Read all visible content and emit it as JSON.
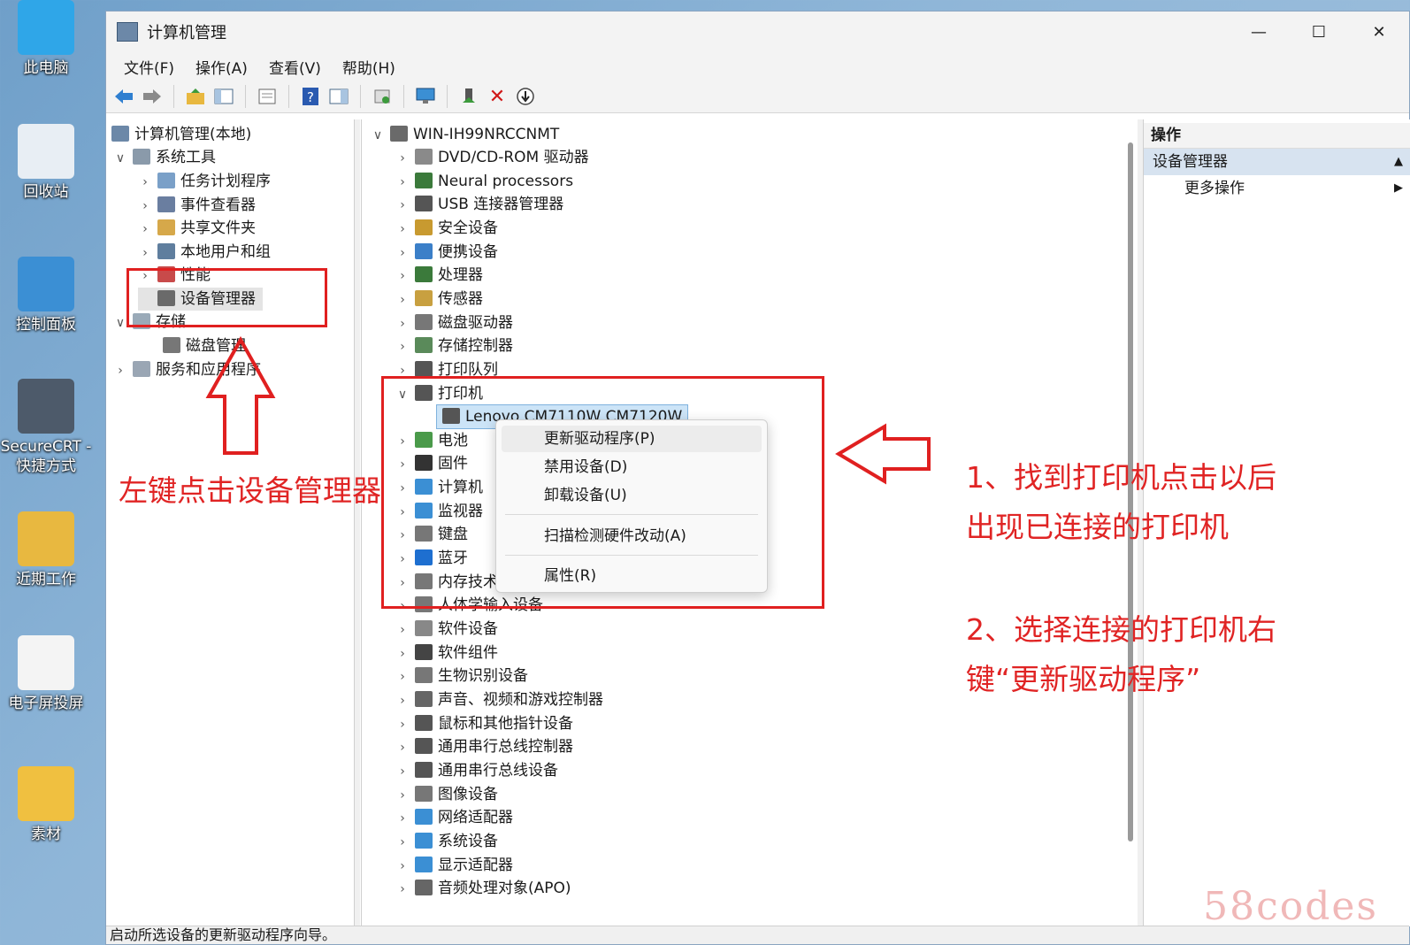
{
  "desktop": {
    "icons": [
      {
        "label": "此电脑",
        "color": "#2fa6e8"
      },
      {
        "label": "回收站",
        "color": "#e8eef4"
      },
      {
        "label": "控制面板",
        "color": "#3b8fd4"
      },
      {
        "label": "SecureCRT - 快捷方式",
        "color": "#4d5a6a"
      },
      {
        "label": "近期工作",
        "color": "#e8b840"
      },
      {
        "label": "电子屏投屏",
        "color": "#f4f4f4"
      },
      {
        "label": "素材",
        "color": "#f0c040"
      }
    ]
  },
  "window": {
    "title": "计算机管理",
    "controls": {
      "minimize": "—",
      "maximize": "☐",
      "close": "✕"
    },
    "menu": [
      "文件(F)",
      "操作(A)",
      "查看(V)",
      "帮助(H)"
    ],
    "toolbar_icons": [
      "back-arrow",
      "forward-arrow",
      "up-folder",
      "show-hide-tree",
      "properties",
      "help",
      "show-pane",
      "export",
      "scan-hardware",
      "add-driver",
      "uninstall",
      "update-driver"
    ]
  },
  "left_tree": {
    "root": "计算机管理(本地)",
    "system_tools": "系统工具",
    "items": [
      {
        "label": "任务计划程序",
        "icon": "clock",
        "color": "#7aa0c8"
      },
      {
        "label": "事件查看器",
        "icon": "event",
        "color": "#6a7ea0"
      },
      {
        "label": "共享文件夹",
        "icon": "shared-folder",
        "color": "#d6a84a"
      },
      {
        "label": "本地用户和组",
        "icon": "users",
        "color": "#5f7e9e"
      },
      {
        "label": "性能",
        "icon": "performance",
        "color": "#c84a4a"
      },
      {
        "label": "设备管理器",
        "icon": "device-manager",
        "color": "#6a6a6a"
      }
    ],
    "storage": "存储",
    "disk_mgmt": "磁盘管理",
    "services": "服务和应用程序"
  },
  "device_tree": {
    "root": "WIN-IH99NRCCNMT",
    "categories": [
      {
        "label": "DVD/CD-ROM 驱动器",
        "color": "#8a8a8a"
      },
      {
        "label": "Neural processors",
        "color": "#3b7a3b"
      },
      {
        "label": "USB 连接器管理器",
        "color": "#555555"
      },
      {
        "label": "安全设备",
        "color": "#c89a30"
      },
      {
        "label": "便携设备",
        "color": "#3b7fc8"
      },
      {
        "label": "处理器",
        "color": "#3b7a3b"
      },
      {
        "label": "传感器",
        "color": "#c8a040"
      },
      {
        "label": "磁盘驱动器",
        "color": "#777777"
      },
      {
        "label": "存储控制器",
        "color": "#5a8a5a"
      },
      {
        "label": "打印队列",
        "color": "#555555"
      },
      {
        "label": "打印机",
        "color": "#555555",
        "expanded": true
      },
      {
        "label": "电池",
        "color": "#4a9a4a"
      },
      {
        "label": "固件",
        "color": "#333333"
      },
      {
        "label": "计算机",
        "color": "#3b8fd4"
      },
      {
        "label": "监视器",
        "color": "#3b8fd4"
      },
      {
        "label": "键盘",
        "color": "#777777"
      },
      {
        "label": "蓝牙",
        "color": "#1e6fd0"
      },
      {
        "label": "内存技术设备",
        "color": "#777777"
      },
      {
        "label": "人体学输入设备",
        "color": "#777777"
      },
      {
        "label": "软件设备",
        "color": "#888888"
      },
      {
        "label": "软件组件",
        "color": "#444444"
      },
      {
        "label": "生物识别设备",
        "color": "#777777"
      },
      {
        "label": "声音、视频和游戏控制器",
        "color": "#666666"
      },
      {
        "label": "鼠标和其他指针设备",
        "color": "#555555"
      },
      {
        "label": "通用串行总线控制器",
        "color": "#555555"
      },
      {
        "label": "通用串行总线设备",
        "color": "#555555"
      },
      {
        "label": "图像设备",
        "color": "#777777"
      },
      {
        "label": "网络适配器",
        "color": "#3b8fd4"
      },
      {
        "label": "系统设备",
        "color": "#3b8fd4"
      },
      {
        "label": "显示适配器",
        "color": "#3b8fd4"
      },
      {
        "label": "音频处理对象(APO)",
        "color": "#666666"
      }
    ],
    "printer_child": "Lenovo CM7110W CM7120W"
  },
  "context_menu": {
    "update": "更新驱动程序(P)",
    "disable": "禁用设备(D)",
    "uninstall": "卸载设备(U)",
    "scan": "扫描检测硬件改动(A)",
    "properties": "属性(R)"
  },
  "actions": {
    "header": "操作",
    "group": "设备管理器",
    "more": "更多操作"
  },
  "status_text": "启动所选设备的更新驱动程序向导。",
  "annotations": {
    "left_tip": "左键点击设备管理器",
    "step1_line1": "1、找到打印机点击以后",
    "step1_line2": "出现已连接的打印机",
    "step2_line1": "2、选择连接的打印机右",
    "step2_line2": "键“更新驱动程序”",
    "color": "#e02424"
  },
  "watermark": "58codes"
}
